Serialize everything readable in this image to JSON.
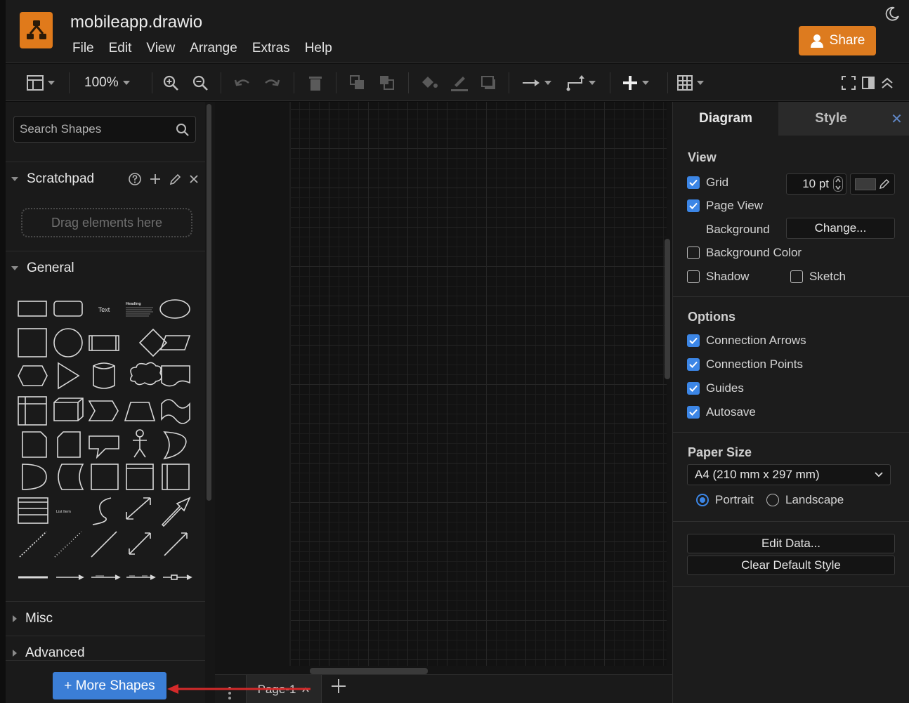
{
  "app": {
    "doc_title": "mobileapp.drawio",
    "menu": [
      "File",
      "Edit",
      "View",
      "Arrange",
      "Extras",
      "Help"
    ],
    "share_label": "Share"
  },
  "toolbar": {
    "zoom": "100%",
    "icons": [
      "format-panel-icon",
      "zoom-in-icon",
      "zoom-out-icon",
      "undo-icon",
      "redo-icon",
      "delete-icon",
      "to-front-icon",
      "to-back-icon",
      "fill-color-icon",
      "line-color-icon",
      "shadow-icon",
      "connection-icon",
      "waypoints-icon",
      "insert-icon",
      "table-icon",
      "fullscreen-icon",
      "toggle-panel-icon",
      "collapse-icon"
    ]
  },
  "left": {
    "search_placeholder": "Search Shapes",
    "scratchpad": "Scratchpad",
    "drop_hint": "Drag elements here",
    "general": "General",
    "misc": "Misc",
    "advanced": "Advanced",
    "more_shapes": "+ More Shapes",
    "shape_text": "Text",
    "shape_heading": "Heading",
    "shape_list_item": "List Item"
  },
  "pages": {
    "current": "Page-1"
  },
  "right": {
    "tab_diagram": "Diagram",
    "tab_style": "Style",
    "close": "✕",
    "view_heading": "View",
    "grid_label": "Grid",
    "grid_size": "10 pt",
    "page_view_label": "Page View",
    "background_label": "Background",
    "change_btn": "Change...",
    "bg_color_label": "Background Color",
    "shadow_label": "Shadow",
    "sketch_label": "Sketch",
    "options_heading": "Options",
    "conn_arrows": "Connection Arrows",
    "conn_points": "Connection Points",
    "guides": "Guides",
    "autosave": "Autosave",
    "paper_heading": "Paper Size",
    "paper_value": "A4 (210 mm x 297 mm)",
    "portrait": "Portrait",
    "landscape": "Landscape",
    "edit_data": "Edit Data...",
    "clear_style": "Clear Default Style"
  },
  "colors": {
    "accent": "#3c86e6",
    "brand": "#dd7b1f",
    "annotation_arrow": "#d42a2a"
  }
}
